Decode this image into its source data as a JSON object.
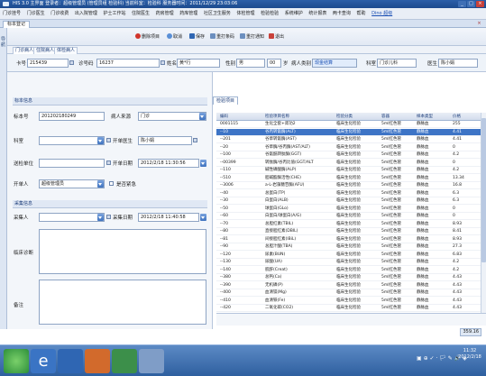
{
  "window": {
    "title": "HIS 3.0 主界面   登录者：超级管理员 (管理员组 检验科)  当前科室：检验科  服务器时间：2011/12/29 23:03:06",
    "min": "_",
    "max": "□",
    "close": "×"
  },
  "menu": [
    "门诊挂号",
    "门诊医生",
    "门诊收费",
    "出入院管理",
    "护士工作站",
    "住院医生",
    "药房管理",
    "药库管理",
    "社区卫生服务",
    "体检管理",
    "检验检验",
    "系统维护",
    "统计报表",
    "两卡查询",
    "帮助"
  ],
  "menu_user": "Dino 超级",
  "module_tab": "标本登记",
  "left_rail_label": "导航",
  "toolbar": {
    "delete": "删除项目",
    "cancel": "取消",
    "save": "保存",
    "reprint_barcode": "重打条码",
    "reprint_slip": "重打通知",
    "exit": "退出"
  },
  "subtabs": [
    "门诊病人",
    "住院病人",
    "体检病人"
  ],
  "patient": {
    "card_label": "卡号",
    "card_value": "215439",
    "clinic_no_label": "诊号码",
    "clinic_no_value": "16237",
    "name_label": "姓名",
    "name_value": "黄*行",
    "sex_label": "性别",
    "sex_value": "男",
    "age_value": "00",
    "age_unit": "岁",
    "patient_type_label": "病人类别",
    "patient_type_value": "现金结算",
    "dept_label": "科室",
    "dept_value": "门诊儿科",
    "doctor_label": "医生",
    "doctor_value": "陈小娟"
  },
  "specimen": {
    "section_title": "标本信息",
    "no_label": "标本号",
    "no_value": "201202180249",
    "source_label": "病人来源",
    "source_value": "门诊",
    "dept_label": "科室",
    "dept_value": "",
    "req_doctor_label": "开单医生",
    "req_doctor_value": "陈小娟",
    "unit_label": "送检单位",
    "unit_value": "",
    "req_date_label": "开单日期",
    "req_date_value": "2012/2/18 11:30:56",
    "operator_label": "开单人",
    "operator_value": "超级管理员",
    "urgent_label": "是否紧急",
    "collect_title": "采集信息",
    "collector_label": "采集人",
    "collector_value": "",
    "collect_date_label": "采集日期",
    "collect_date_value": "2012/2/18 11:40:58",
    "clinical_dx_label": "临床诊断",
    "remark_label": "备注"
  },
  "grid": {
    "tab": "检验项目",
    "columns": [
      "编码",
      "检验项目名称",
      "检验分类",
      "容器",
      "样本类型",
      "价格"
    ],
    "rows": [
      [
        "0001115",
        "生化全套+肾功2",
        "临床生化检验",
        "5ml红色管",
        "静脉血",
        "255"
      ],
      [
        "--10",
        "谷丙转氨酶(ALT)",
        "临床生化检验",
        "5ml红色管",
        "静脉血",
        "4.41"
      ],
      [
        "--201",
        "谷草转氨酶(AST)",
        "临床生化检验",
        "5ml红色管",
        "静脉血",
        "4.41"
      ],
      [
        "--20",
        "谷草酶/谷丙酶(AST/ALT)",
        "临床生化检验",
        "5ml红色管",
        "静脉血",
        "0"
      ],
      [
        "--100",
        "谷氨酰转肽酶(GGT)",
        "临床生化检验",
        "5ml红色管",
        "静脉血",
        "4.2"
      ],
      [
        "--00399",
        "转肽酶/谷丙比值(GGT/ALT",
        "临床生化检验",
        "5ml红色管",
        "静脉血",
        "0"
      ],
      [
        "--110",
        "碱性磷酸酶(ALP)",
        "临床生化检验",
        "5ml红色管",
        "静脉血",
        "4.2"
      ],
      [
        "--510",
        "胆碱酯酶活性(CHE)",
        "临床生化检验",
        "5ml红色管",
        "静脉血",
        "13.34"
      ],
      [
        "--3006",
        "a-L-岩藻糖苷酶(AFU)",
        "临床生化检验",
        "5ml红色管",
        "静脉血",
        "16.8"
      ],
      [
        "--40",
        "总蛋白(TP)",
        "临床生化检验",
        "5ml红色管",
        "静脉血",
        "6.3"
      ],
      [
        "--30",
        "白蛋白(ALB)",
        "临床生化检验",
        "5ml红色管",
        "静脉血",
        "6.3"
      ],
      [
        "--50",
        "球蛋白(GLo)",
        "临床生化检验",
        "5ml红色管",
        "静脉血",
        "0"
      ],
      [
        "--60",
        "白蛋白/球蛋白(A/G)",
        "临床生化检验",
        "5ml红色管",
        "静脉血",
        "0"
      ],
      [
        "--70",
        "总胆红素(TBIL)",
        "临床生化检验",
        "5ml红色管",
        "静脉血",
        "8.93"
      ],
      [
        "--80",
        "直接胆红素(DBIL)",
        "临床生化检验",
        "5ml红色管",
        "静脉血",
        "8.41"
      ],
      [
        "--81",
        "间接胆红素(IBiL)",
        "临床生化检验",
        "5ml红色管",
        "静脉血",
        "8.93"
      ],
      [
        "--90",
        "总胆汁酸(TBA)",
        "临床生化检验",
        "5ml红色管",
        "静脉血",
        "27.3"
      ],
      [
        "--120",
        "尿素(BUN)",
        "临床生化检验",
        "5ml红色管",
        "静脉血",
        "6.83"
      ],
      [
        "--130",
        "尿酸(UA)",
        "临床生化检验",
        "5ml红色管",
        "静脉血",
        "4.2"
      ],
      [
        "--140",
        "肌酐(Creat)",
        "临床生化检验",
        "5ml红色管",
        "静脉血",
        "4.2"
      ],
      [
        "--380",
        "总钙(Ca)",
        "临床生化检验",
        "5ml红色管",
        "静脉血",
        "4.43"
      ],
      [
        "--390",
        "无机磷(P)",
        "临床生化检验",
        "5ml红色管",
        "静脉血",
        "4.43"
      ],
      [
        "--400",
        "血清镁(Mg)",
        "临床生化检验",
        "5ml红色管",
        "静脉血",
        "4.43"
      ],
      [
        "--410",
        "血清铁(Fe)",
        "临床生化检验",
        "5ml红色管",
        "静脉血",
        "4.43"
      ],
      [
        "--420",
        "二氧化碳(CO2)",
        "临床生化检验",
        "5ml红色管",
        "静脉血",
        "4.43"
      ]
    ],
    "total": "359.16"
  },
  "taskbar": {
    "time": "11:32",
    "date": "2012/2/18",
    "tray": "▣ ⊕ ✓ · 🏳 ✎ 🔊 ◈"
  },
  "colors": {
    "title_bar": "#1c4a8e",
    "selection": "#3d74c6",
    "taskbar": "#2e5f9f"
  }
}
